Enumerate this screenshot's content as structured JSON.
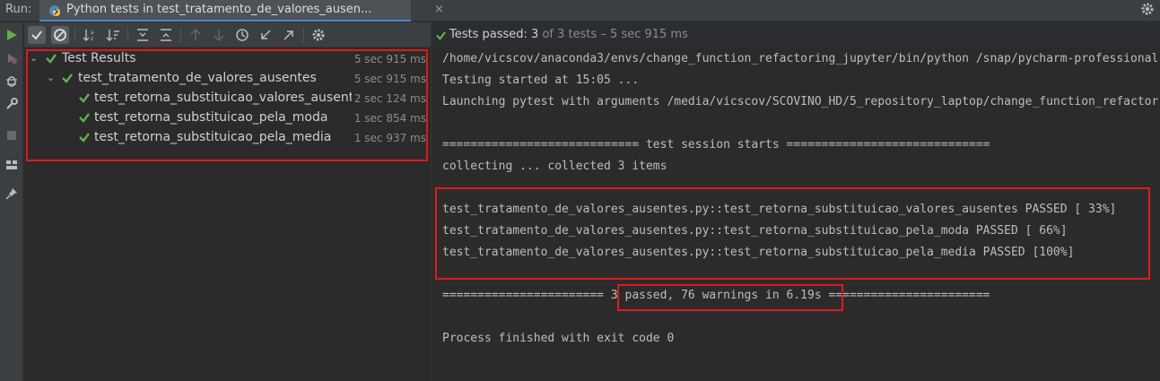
{
  "topbar": {
    "run_label": "Run:",
    "tab_title": "Python tests in test_tratamento_de_valores_ausen...",
    "tab_close": "×",
    "tab_icon": "python-test-icon",
    "settings_icon": "gear-icon"
  },
  "left_toolbar": [
    "run-icon",
    "rerun-failed-icon",
    "debug-icon",
    "wrench-icon",
    "stop-icon",
    "layout-icon",
    "pin-icon"
  ],
  "tree_toolbar": [
    "show-passed-icon",
    "show-ignored-icon",
    "sort-alpha-icon",
    "sort-duration-icon",
    "expand-all-icon",
    "collapse-all-icon",
    "prev-failed-icon",
    "next-failed-icon",
    "history-icon",
    "import-icon",
    "export-icon",
    "settings-icon"
  ],
  "tree": {
    "root": {
      "name": "Test Results",
      "time": "5 sec 915 ms"
    },
    "suite": {
      "name": "test_tratamento_de_valores_ausentes",
      "time": "5 sec 915 ms"
    },
    "tests": [
      {
        "name": "test_retorna_substituicao_valores_ausentes",
        "time": "2 sec 124 ms"
      },
      {
        "name": "test_retorna_substituicao_pela_moda",
        "time": "1 sec 854 ms"
      },
      {
        "name": "test_retorna_substituicao_pela_media",
        "time": "1 sec 937 ms"
      }
    ]
  },
  "console_header": {
    "passed_label": "Tests passed:",
    "passed_count": "3",
    "rest": "of 3 tests – 5 sec 915 ms"
  },
  "console": {
    "lines": [
      "/home/vicscov/anaconda3/envs/change_function_refactoring_jupyter/bin/python /snap/pycharm-professional",
      "Testing started at 15:05 ...",
      "Launching pytest with arguments /media/vicscov/SCOVINO_HD/5_repository_laptop/change_function_refactor",
      "",
      "============================ test session starts =============================",
      "collecting ... collected 3 items",
      "",
      "test_tratamento_de_valores_ausentes.py::test_retorna_substituicao_valores_ausentes PASSED [ 33%]",
      "test_tratamento_de_valores_ausentes.py::test_retorna_substituicao_pela_moda PASSED [ 66%]",
      "test_tratamento_de_valores_ausentes.py::test_retorna_substituicao_pela_media PASSED [100%]",
      "",
      "======================= 3 passed, 76 warnings in 6.19s =======================",
      "",
      "Process finished with exit code 0"
    ]
  },
  "colors": {
    "pass_green": "#5fb04c",
    "highlight_red": "#e0191b",
    "tab_accent": "#4a88c7"
  }
}
